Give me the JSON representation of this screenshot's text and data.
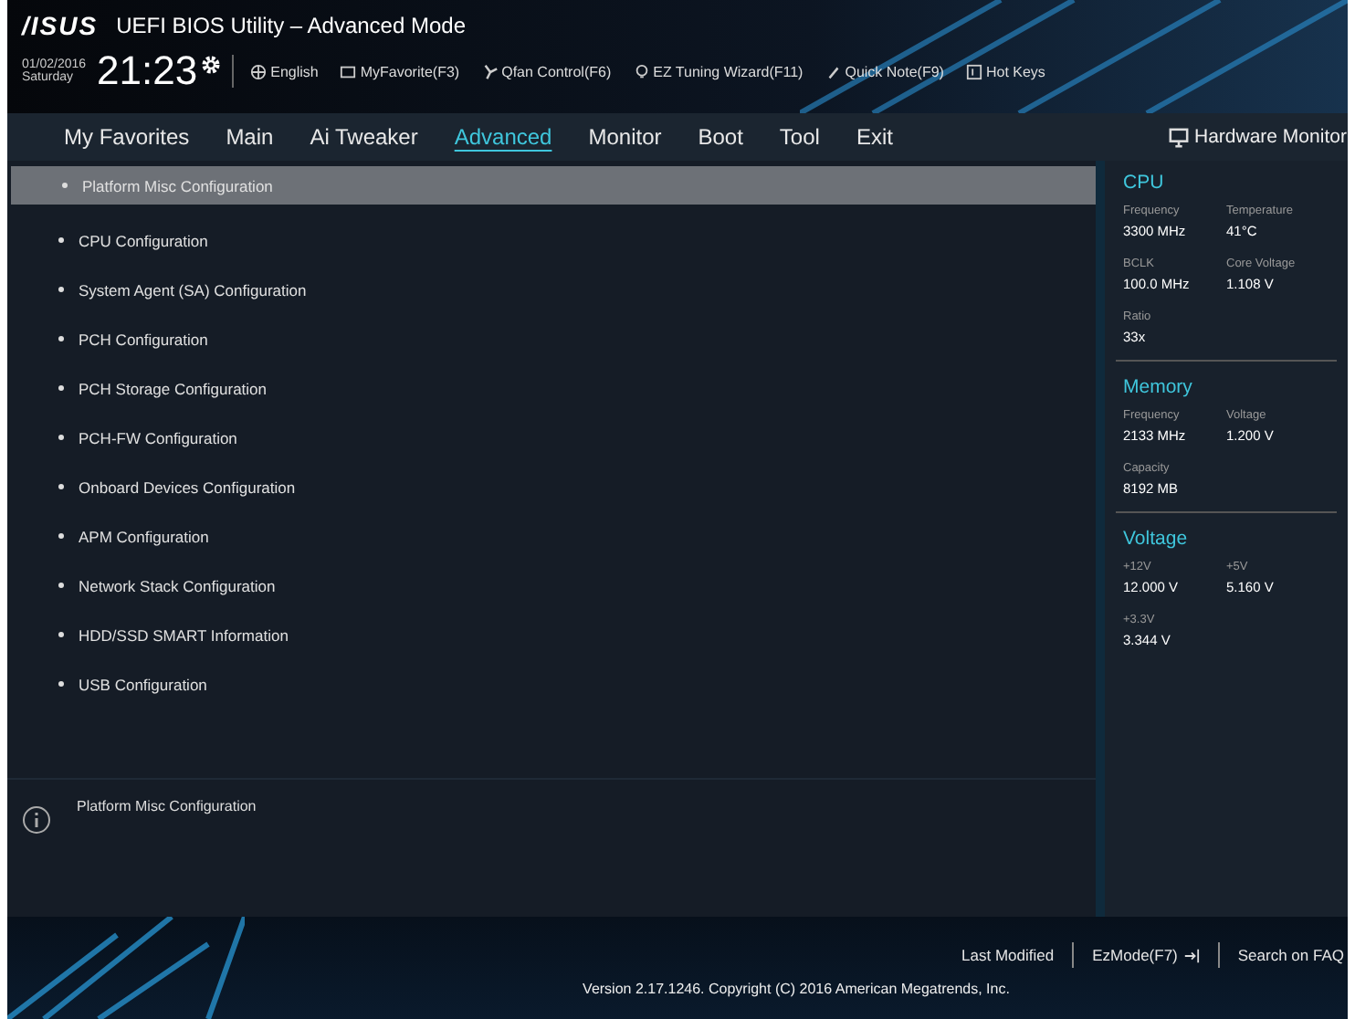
{
  "window": {
    "logo": "/ISUS",
    "title": "UEFI BIOS Utility – Advanced Mode"
  },
  "clock": {
    "date": "01/02/2016",
    "day": "Saturday",
    "time": "21:23"
  },
  "toolbar": [
    {
      "label": "English"
    },
    {
      "label": "MyFavorite(F3)"
    },
    {
      "label": "Qfan Control(F6)"
    },
    {
      "label": "EZ Tuning Wizard(F11)"
    },
    {
      "label": "Quick Note(F9)"
    },
    {
      "label": "Hot Keys"
    }
  ],
  "tabs": [
    {
      "label": "My Favorites",
      "selected": false
    },
    {
      "label": "Main",
      "selected": false
    },
    {
      "label": "Ai Tweaker",
      "selected": false
    },
    {
      "label": "Advanced",
      "selected": true
    },
    {
      "label": "Monitor",
      "selected": false
    },
    {
      "label": "Boot",
      "selected": false
    },
    {
      "label": "Tool",
      "selected": false
    },
    {
      "label": "Exit",
      "selected": false
    }
  ],
  "menu": [
    {
      "label": "Platform Misc Configuration",
      "selected": true
    },
    {
      "label": "CPU Configuration",
      "selected": false
    },
    {
      "label": "System Agent (SA) Configuration",
      "selected": false
    },
    {
      "label": "PCH Configuration",
      "selected": false
    },
    {
      "label": "PCH Storage Configuration",
      "selected": false
    },
    {
      "label": "PCH-FW Configuration",
      "selected": false
    },
    {
      "label": "Onboard Devices Configuration",
      "selected": false
    },
    {
      "label": "APM Configuration",
      "selected": false
    },
    {
      "label": "Network Stack Configuration",
      "selected": false
    },
    {
      "label": "HDD/SSD SMART Information",
      "selected": false
    },
    {
      "label": "USB Configuration",
      "selected": false
    }
  ],
  "info": {
    "text": "Platform Misc Configuration"
  },
  "hardware_monitor": {
    "title": "Hardware Monitor",
    "sections": [
      {
        "title": "CPU",
        "items": [
          {
            "label": "Frequency",
            "value": "3300 MHz"
          },
          {
            "label": "Temperature",
            "value": "41°C"
          },
          {
            "label": "BCLK",
            "value": "100.0 MHz"
          },
          {
            "label": "Core Voltage",
            "value": "1.108 V"
          },
          {
            "label": "Ratio",
            "value": "33x"
          }
        ]
      },
      {
        "title": "Memory",
        "items": [
          {
            "label": "Frequency",
            "value": "2133 MHz"
          },
          {
            "label": "Voltage",
            "value": "1.200 V"
          },
          {
            "label": "Capacity",
            "value": "8192 MB"
          }
        ]
      },
      {
        "title": "Voltage",
        "items": [
          {
            "label": "+12V",
            "value": "12.000 V"
          },
          {
            "label": "+5V",
            "value": "5.160 V"
          },
          {
            "label": "+3.3V",
            "value": "3.344 V"
          }
        ]
      }
    ]
  },
  "footer": {
    "links": [
      {
        "label": "Last Modified",
        "kind": "text"
      },
      {
        "label": "EzMode(F7)",
        "kind": "exit"
      },
      {
        "label": "Search on FAQ",
        "kind": "text"
      }
    ],
    "version": "Version 2.17.1246. Copyright (C) 2016 American Megatrends, Inc."
  }
}
